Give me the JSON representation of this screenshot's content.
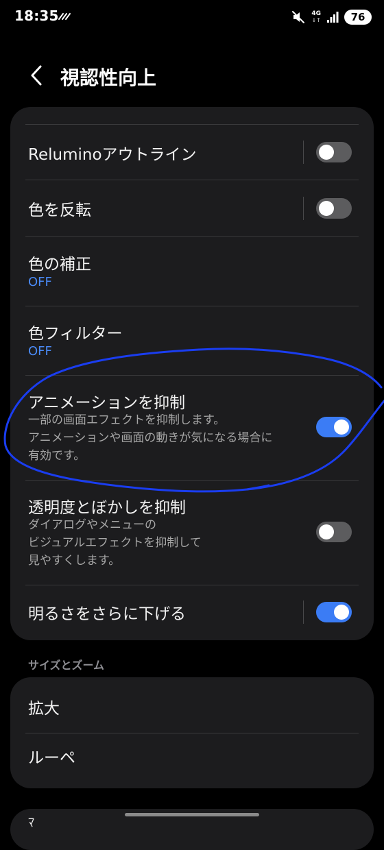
{
  "status_bar": {
    "time": "18:35",
    "network": "4G",
    "network_arrows": "↓↑",
    "battery": "76"
  },
  "header": {
    "title": "視認性向上"
  },
  "settings": [
    {
      "title": "Reluminoアウトライン",
      "toggle": false
    },
    {
      "title": "色を反転",
      "toggle": false
    },
    {
      "title": "色の補正",
      "status": "OFF"
    },
    {
      "title": "色フィルター",
      "status": "OFF"
    },
    {
      "title": "アニメーションを抑制",
      "description": [
        "一部の画面エフェクトを抑制します。",
        "アニメーションや画面の動きが気になる場合に",
        "有効です。"
      ],
      "toggle": true
    },
    {
      "title": "透明度とぼかしを抑制",
      "description": [
        "ダイアログやメニューの",
        "ビジュアルエフェクトを抑制して",
        "見やすくします。"
      ],
      "toggle": false
    },
    {
      "title": "明るさをさらに下げる",
      "toggle": true
    }
  ],
  "section_size_zoom": {
    "label": "サイズとズーム",
    "items": [
      "拡大",
      "ルーペ"
    ]
  },
  "peek_text": "ﾏ",
  "colors": {
    "background": "#000000",
    "card": "#1c1c1e",
    "accent": "#3b7cf5",
    "status_text": "#4a8af6",
    "annotation": "#1a3df0"
  },
  "icons": {
    "back": "chevron-left-icon",
    "mute": "volume-mute-icon",
    "signal": "signal-bars-icon",
    "activity": "activity-icon"
  }
}
